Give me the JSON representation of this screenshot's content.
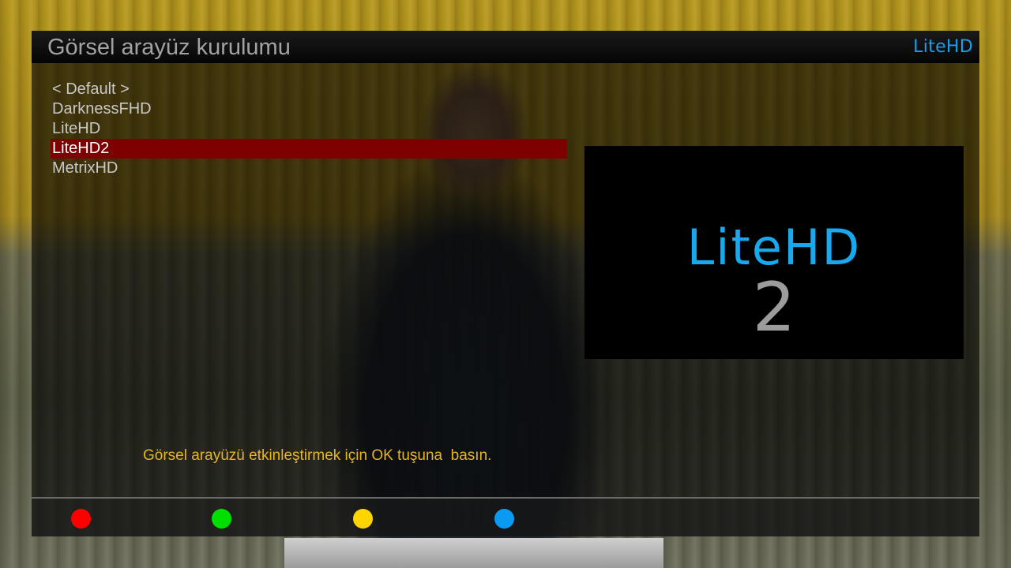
{
  "header": {
    "title": "Görsel arayüz kurulumu",
    "brand": "LiteHD"
  },
  "skins": {
    "items": [
      {
        "label": "< Default >"
      },
      {
        "label": "DarknessFHD"
      },
      {
        "label": "LiteHD"
      },
      {
        "label": "LiteHD2",
        "selected": true
      },
      {
        "label": "MetrixHD"
      }
    ]
  },
  "preview": {
    "logo_text": "LiteHD",
    "logo_number": "2",
    "logo_color": "#18a8ee"
  },
  "hint": "Görsel arayüzü etkinleştirmek için OK tuşuna  basın.",
  "colors": {
    "selection": "#7e0000",
    "hint": "#e7b51c",
    "brand": "#1e9ee8"
  },
  "color_buttons": [
    {
      "name": "red-button",
      "color": "#ff0000"
    },
    {
      "name": "green-button",
      "color": "#00e000"
    },
    {
      "name": "yellow-button",
      "color": "#ffd500"
    },
    {
      "name": "blue-button",
      "color": "#0a9af2"
    }
  ]
}
